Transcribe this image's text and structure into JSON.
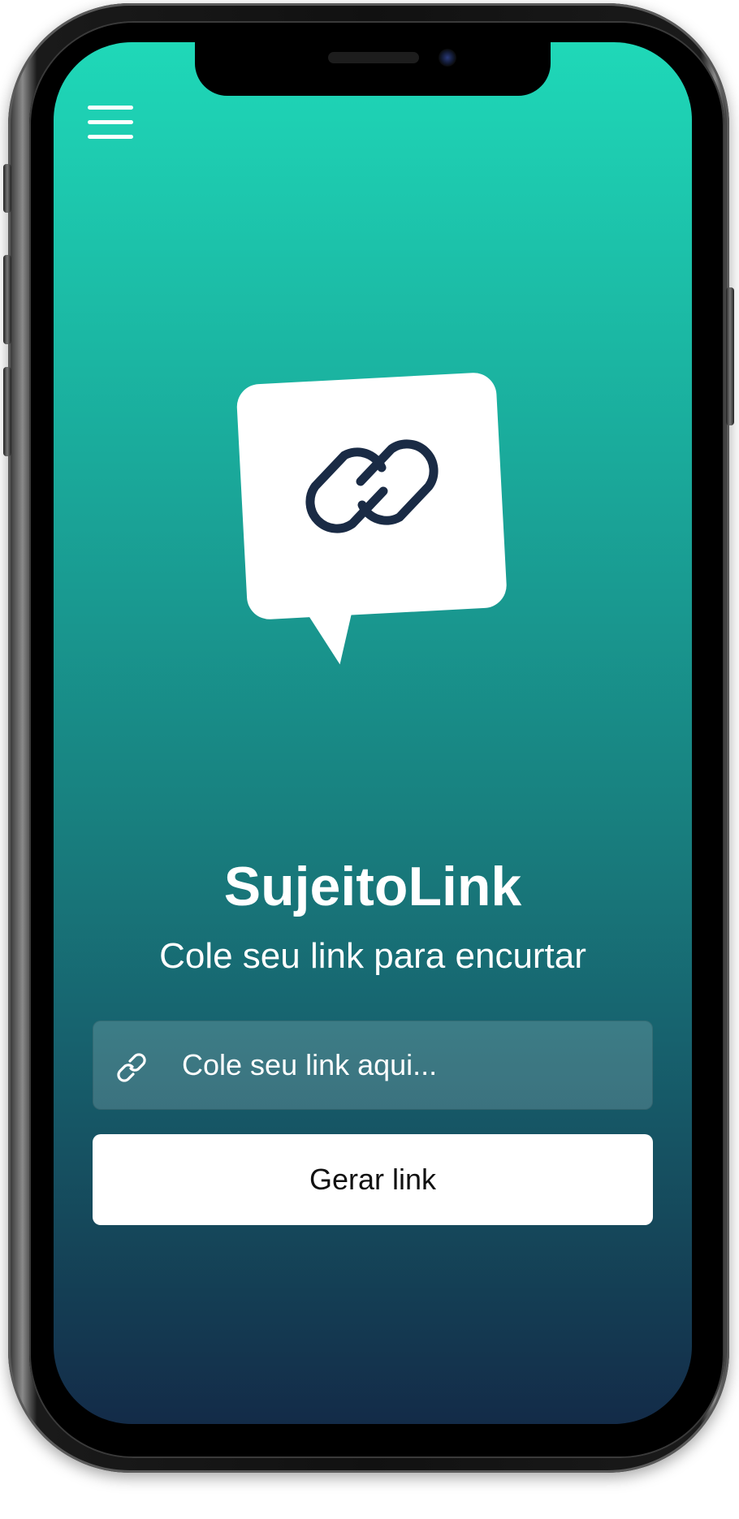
{
  "app": {
    "name": "SujeitoLink",
    "subtitle": "Cole seu link para encurtar"
  },
  "header": {
    "menu_icon": "hamburger-menu-icon"
  },
  "logo": {
    "icon": "chat-bubble-link-icon",
    "bubble_color": "#ffffff",
    "link_color": "#1a2b45"
  },
  "form": {
    "input_icon": "link-icon",
    "input_placeholder": "Cole seu link aqui...",
    "input_value": "",
    "button_label": "Gerar link"
  },
  "colors": {
    "gradient_top": "#1fd8b8",
    "gradient_bottom": "#132b48",
    "button_background": "#ffffff",
    "text": "#ffffff"
  }
}
